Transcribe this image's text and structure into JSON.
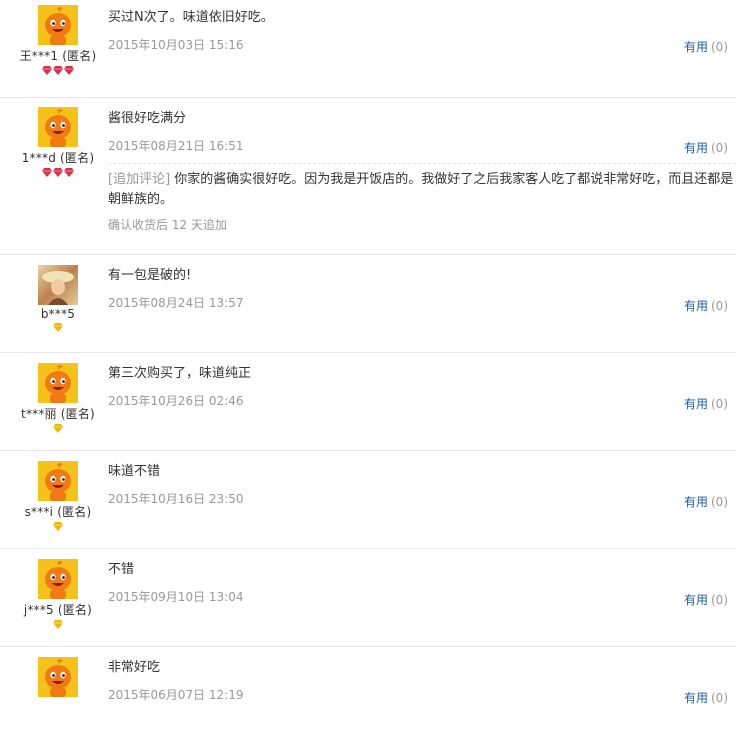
{
  "reviews": [
    {
      "user": "王***1 (匿名)",
      "avatar": "taobao-mascot",
      "rank_icons": [
        "red-diamond",
        "red-diamond",
        "red-diamond"
      ],
      "text": "买过N次了。味道依旧好吃。",
      "date": "2015年10月03日 15:16",
      "useful_label": "有用",
      "useful_count": "(0)"
    },
    {
      "user": "1***d (匿名)",
      "avatar": "taobao-mascot",
      "rank_icons": [
        "red-diamond",
        "red-diamond",
        "red-diamond"
      ],
      "text": "酱很好吃满分",
      "date": "2015年08月21日 16:51",
      "useful_label": "有用",
      "useful_count": "(0)",
      "append_tag": "[追加评论]",
      "append_text": "你家的酱确实很好吃。因为我是开饭店的。我做好了之后我家客人吃了都说非常好吃，而且还都是朝鲜族的。",
      "append_note": "确认收货后 12 天追加"
    },
    {
      "user": "b***5",
      "avatar": "photo",
      "rank_icons": [
        "yellow-diamond"
      ],
      "text": "有一包是破的!",
      "date": "2015年08月24日 13:57",
      "useful_label": "有用",
      "useful_count": "(0)"
    },
    {
      "user": "t***丽 (匿名)",
      "avatar": "taobao-mascot",
      "rank_icons": [
        "yellow-diamond"
      ],
      "text": "第三次购买了，味道纯正",
      "date": "2015年10月26日 02:46",
      "useful_label": "有用",
      "useful_count": "(0)"
    },
    {
      "user": "s***i (匿名)",
      "avatar": "taobao-mascot",
      "rank_icons": [
        "yellow-diamond"
      ],
      "text": "味道不错",
      "date": "2015年10月16日 23:50",
      "useful_label": "有用",
      "useful_count": "(0)"
    },
    {
      "user": "j***5 (匿名)",
      "avatar": "taobao-mascot",
      "rank_icons": [
        "yellow-diamond"
      ],
      "text": "不错",
      "date": "2015年09月10日 13:04",
      "useful_label": "有用",
      "useful_count": "(0)"
    },
    {
      "user": "",
      "avatar": "taobao-mascot",
      "rank_icons": [],
      "text": "非常好吃",
      "date": "2015年06月07日 12:19",
      "useful_label": "有用",
      "useful_count": "(0)"
    }
  ],
  "colors": {
    "link": "#1f5d9a",
    "muted": "#999999",
    "mascot_bg": "#f6c21a",
    "mascot_body": "#f07a13",
    "red_diamond": "#d9304a",
    "yellow_diamond": "#f2b705"
  }
}
